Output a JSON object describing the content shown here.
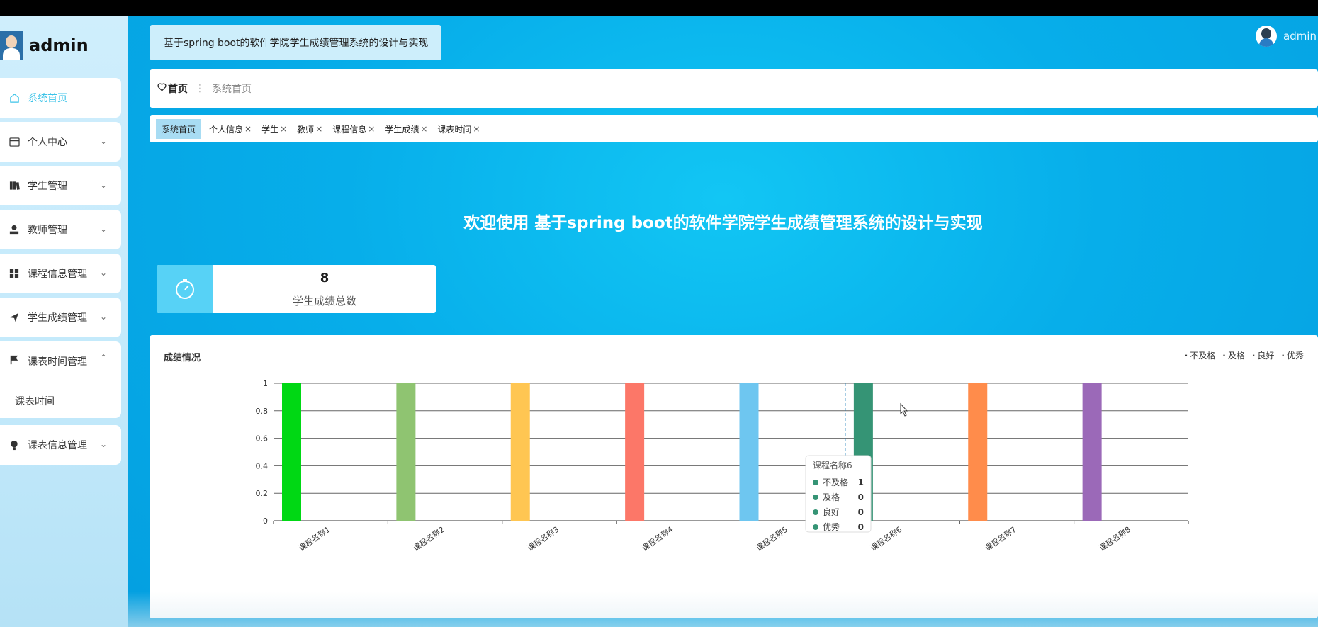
{
  "sidebar": {
    "brand_name": "admin",
    "items": [
      {
        "label": "系统首页"
      },
      {
        "label": "个人中心"
      },
      {
        "label": "学生管理"
      },
      {
        "label": "教师管理"
      },
      {
        "label": "课程信息管理"
      },
      {
        "label": "学生成绩管理"
      },
      {
        "label": "课表时间管理"
      },
      {
        "label": "课表信息管理"
      }
    ],
    "submenu_item": "课表时间"
  },
  "header": {
    "title": "基于spring boot的软件学院学生成绩管理系统的设计与实现",
    "user": "admin"
  },
  "breadcrumb": {
    "home": "首页",
    "current": "系统首页"
  },
  "tags": [
    {
      "label": "系统首页"
    },
    {
      "label": "个人信息"
    },
    {
      "label": "学生"
    },
    {
      "label": "教师"
    },
    {
      "label": "课程信息"
    },
    {
      "label": "学生成绩"
    },
    {
      "label": "课表时间"
    }
  ],
  "welcome": "欢迎使用 基于spring boot的软件学院学生成绩管理系统的设计与实现",
  "stat": {
    "value": "8",
    "label": "学生成绩总数"
  },
  "chart": {
    "title": "成绩情况",
    "tooltip": {
      "title": "课程名称6",
      "rows": [
        {
          "name": "不及格",
          "value": "1"
        },
        {
          "name": "及格",
          "value": "0"
        },
        {
          "name": "良好",
          "value": "0"
        },
        {
          "name": "优秀",
          "value": "0"
        }
      ]
    }
  },
  "chart_data": {
    "type": "bar",
    "title": "成绩情况",
    "categories": [
      "课程名称1",
      "课程名称2",
      "课程名称3",
      "课程名称4",
      "课程名称5",
      "课程名称6",
      "课程名称7",
      "课程名称8"
    ],
    "series": [
      {
        "name": "不及格",
        "values": [
          1,
          1,
          1,
          1,
          1,
          1,
          1,
          1
        ]
      },
      {
        "name": "及格",
        "values": [
          0,
          0,
          0,
          0,
          0,
          0,
          0,
          0
        ]
      },
      {
        "name": "良好",
        "values": [
          0,
          0,
          0,
          0,
          0,
          0,
          0,
          0
        ]
      },
      {
        "name": "优秀",
        "values": [
          0,
          0,
          0,
          0,
          0,
          0,
          0,
          0
        ]
      }
    ],
    "bar_colors": [
      "#00d814",
      "#8fc471",
      "#ffc652",
      "#fc7768",
      "#6ec6f0",
      "#359475",
      "#ff8c4b",
      "#9b69b8"
    ],
    "yticks": [
      "0",
      "0.2",
      "0.4",
      "0.6",
      "0.8",
      "1"
    ],
    "ylim": [
      0,
      1
    ],
    "legend_position": "top-right",
    "grid": true
  },
  "colors": {
    "accent": "#3cc3e8",
    "main_bg": "#07aeea",
    "sidebar_bg": "#c8ecfb"
  }
}
